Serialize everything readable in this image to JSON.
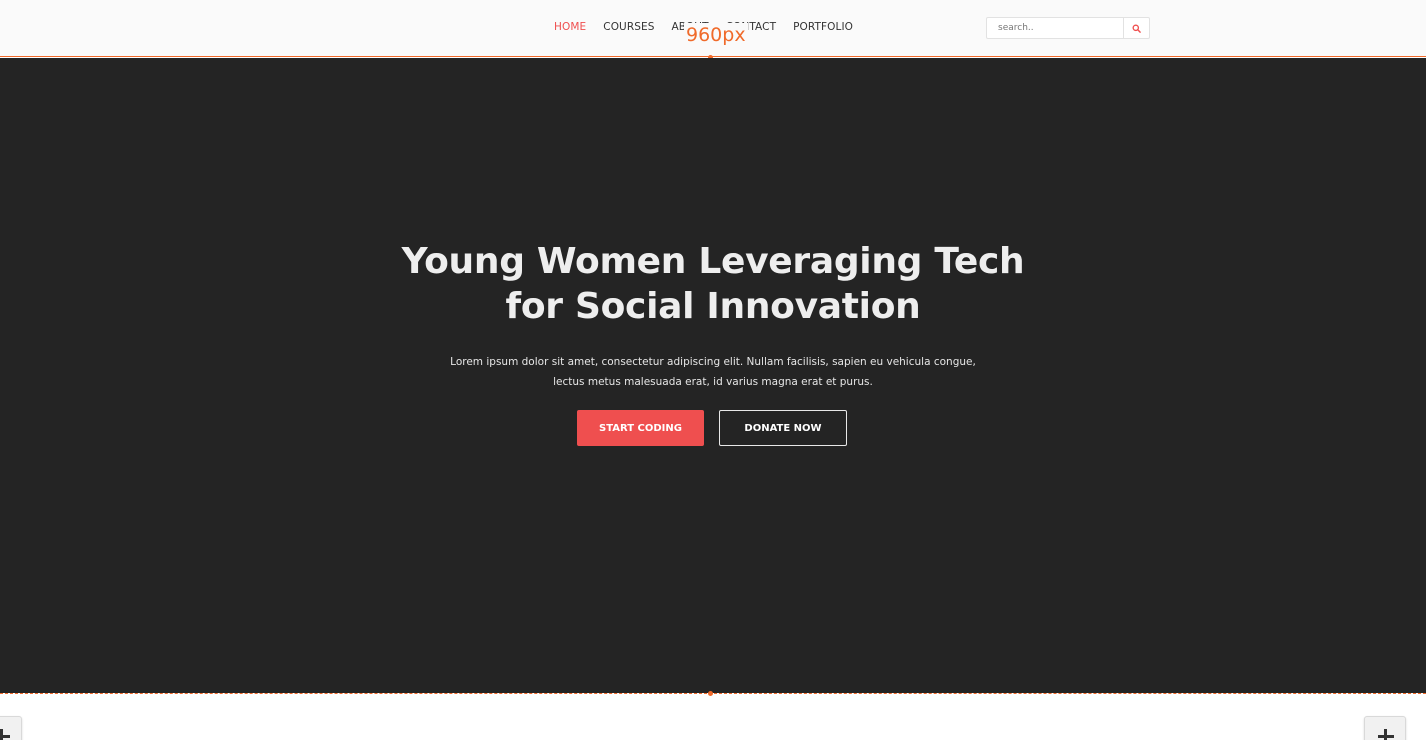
{
  "nav": {
    "items": [
      {
        "label": "HOME",
        "active": true
      },
      {
        "label": "COURSES",
        "active": false
      },
      {
        "label": "ABOUT",
        "active": false
      },
      {
        "label": "CONTACT",
        "active": false
      },
      {
        "label": "PORTFOLIO",
        "active": false
      }
    ],
    "breakpoint_label": "960px",
    "search": {
      "placeholder": "search..",
      "icon": "search-icon"
    }
  },
  "hero": {
    "title_line1": "Young Women Leveraging Tech",
    "title_line2": "for Social Innovation",
    "text_line1": "Lorem ipsum dolor sit amet, consectetur adipiscing elit. Nullam facilisis, sapien eu vehicula congue,",
    "text_line2": "lectus metus malesuada erat, id varius magna erat et purus.",
    "primary_button": "START CODING",
    "secondary_button": "DONATE NOW"
  },
  "bottom": {
    "left_add_icon": "plus-icon",
    "right_add_icon": "plus-icon"
  },
  "colors": {
    "accent": "#ef4f4f",
    "guide": "#f06a2a",
    "hero_bg": "#242424",
    "navbar_bg": "#fafafa"
  }
}
